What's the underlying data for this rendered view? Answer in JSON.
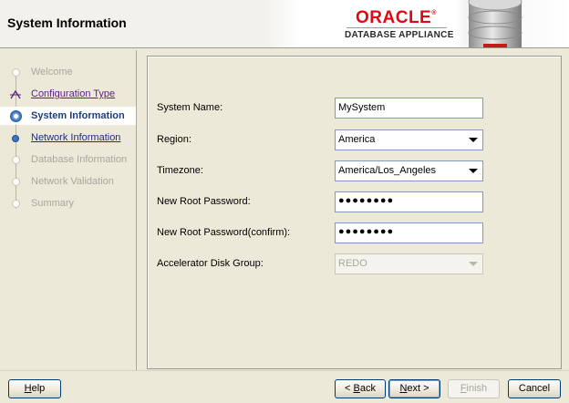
{
  "header": {
    "title": "System Information",
    "brand_name": "ORACLE",
    "brand_subtitle": "DATABASE APPLIANCE",
    "brand_color": "#e30613"
  },
  "nav": {
    "items": [
      {
        "label": "Welcome",
        "state": "disabled"
      },
      {
        "label": "Configuration Type",
        "state": "visited"
      },
      {
        "label": "System Information",
        "state": "current"
      },
      {
        "label": "Network Information",
        "state": "link"
      },
      {
        "label": "Database Information",
        "state": "disabled"
      },
      {
        "label": "Network Validation",
        "state": "disabled"
      },
      {
        "label": "Summary",
        "state": "disabled"
      }
    ]
  },
  "form": {
    "system_name": {
      "label": "System Name:",
      "value": "MySystem"
    },
    "region": {
      "label": "Region:",
      "value": "America"
    },
    "timezone": {
      "label": "Timezone:",
      "value": "America/Los_Angeles"
    },
    "root_password": {
      "label": "New Root Password:",
      "value": "●●●●●●●●"
    },
    "root_password_confirm": {
      "label": "New Root Password(confirm):",
      "value": "●●●●●●●●"
    },
    "accelerator_disk_group": {
      "label": "Accelerator Disk Group:",
      "value": "REDO"
    }
  },
  "buttons": {
    "help": {
      "mnemonic": "H",
      "rest": "elp"
    },
    "back": {
      "prefix": "< ",
      "mnemonic": "B",
      "rest": "ack"
    },
    "next": {
      "mnemonic": "N",
      "rest": "ext >"
    },
    "finish": {
      "mnemonic": "F",
      "rest": "inish"
    },
    "cancel": {
      "label": "Cancel"
    }
  }
}
